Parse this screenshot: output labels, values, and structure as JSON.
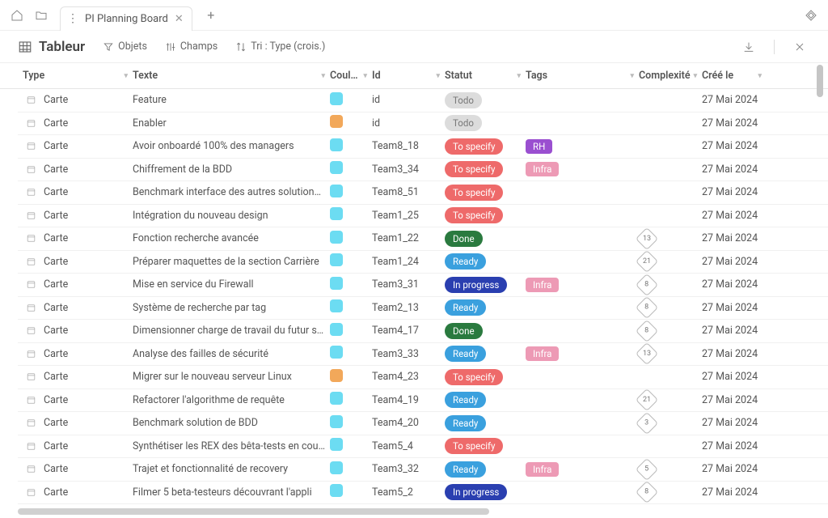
{
  "topbar": {
    "tab_title": "PI Planning Board"
  },
  "toolbar": {
    "title": "Tableur",
    "objets": "Objets",
    "champs": "Champs",
    "tri": "Tri : Type (crois.)"
  },
  "columns": {
    "type": "Type",
    "texte": "Texte",
    "coul": "Coul…",
    "id": "Id",
    "statut": "Statut",
    "tags": "Tags",
    "complex": "Complexité",
    "cree": "Créé le"
  },
  "type_label": "Carte",
  "rows": [
    {
      "texte": "Feature",
      "color": "cyan",
      "id": "id",
      "statut": "Todo",
      "statcls": "b-todo",
      "tag": "",
      "tagcls": "",
      "comp": "",
      "cree": "27 Mai 2024"
    },
    {
      "texte": "Enabler",
      "color": "orange",
      "id": "id",
      "statut": "Todo",
      "statcls": "b-todo",
      "tag": "",
      "tagcls": "",
      "comp": "",
      "cree": "27 Mai 2024"
    },
    {
      "texte": "Avoir onboardé 100% des managers",
      "color": "cyan",
      "id": "Team8_18",
      "statut": "To specify",
      "statcls": "b-spec",
      "tag": "RH",
      "tagcls": "t-rh",
      "comp": "",
      "cree": "27 Mai 2024"
    },
    {
      "texte": "Chiffrement de la BDD",
      "color": "cyan",
      "id": "Team3_34",
      "statut": "To specify",
      "statcls": "b-spec",
      "tag": "Infra",
      "tagcls": "t-infra",
      "comp": "",
      "cree": "27 Mai 2024"
    },
    {
      "texte": "Benchmark interface des autres solutions du marché",
      "color": "cyan",
      "id": "Team8_51",
      "statut": "To specify",
      "statcls": "b-spec",
      "tag": "",
      "tagcls": "",
      "comp": "",
      "cree": "27 Mai 2024"
    },
    {
      "texte": "Intégration du nouveau design",
      "color": "cyan",
      "id": "Team1_25",
      "statut": "To specify",
      "statcls": "b-spec",
      "tag": "",
      "tagcls": "",
      "comp": "",
      "cree": "27 Mai 2024"
    },
    {
      "texte": "Fonction recherche avancée",
      "color": "cyan",
      "id": "Team1_22",
      "statut": "Done",
      "statcls": "b-done",
      "tag": "",
      "tagcls": "",
      "comp": "13",
      "cree": "27 Mai 2024"
    },
    {
      "texte": "Préparer maquettes de la section Carrière",
      "color": "cyan",
      "id": "Team1_24",
      "statut": "Ready",
      "statcls": "b-ready",
      "tag": "",
      "tagcls": "",
      "comp": "21",
      "cree": "27 Mai 2024"
    },
    {
      "texte": "Mise en service du Firewall",
      "color": "cyan",
      "id": "Team3_31",
      "statut": "In progress",
      "statcls": "b-prog",
      "tag": "Infra",
      "tagcls": "t-infra",
      "comp": "8",
      "cree": "27 Mai 2024"
    },
    {
      "texte": "Système de recherche par tag",
      "color": "cyan",
      "id": "Team2_13",
      "statut": "Ready",
      "statcls": "b-ready",
      "tag": "",
      "tagcls": "",
      "comp": "8",
      "cree": "27 Mai 2024"
    },
    {
      "texte": "Dimensionner charge de travail du futur serveur",
      "color": "cyan",
      "id": "Team4_17",
      "statut": "Done",
      "statcls": "b-done",
      "tag": "",
      "tagcls": "",
      "comp": "8",
      "cree": "27 Mai 2024"
    },
    {
      "texte": "Analyse des failles de sécurité",
      "color": "cyan",
      "id": "Team3_33",
      "statut": "Ready",
      "statcls": "b-ready",
      "tag": "Infra",
      "tagcls": "t-infra",
      "comp": "13",
      "cree": "27 Mai 2024"
    },
    {
      "texte": "Migrer sur le nouveau serveur Linux",
      "color": "orange",
      "id": "Team4_23",
      "statut": "To specify",
      "statcls": "b-spec",
      "tag": "",
      "tagcls": "",
      "comp": "",
      "cree": "27 Mai 2024"
    },
    {
      "texte": "Refactorer l'algorithme de requête",
      "color": "cyan",
      "id": "Team4_19",
      "statut": "Ready",
      "statcls": "b-ready",
      "tag": "",
      "tagcls": "",
      "comp": "21",
      "cree": "27 Mai 2024"
    },
    {
      "texte": "Benchmark solution de BDD",
      "color": "cyan",
      "id": "Team4_20",
      "statut": "Ready",
      "statcls": "b-ready",
      "tag": "",
      "tagcls": "",
      "comp": "3",
      "cree": "27 Mai 2024"
    },
    {
      "texte": "Synthétiser les REX des bêta-tests en cours",
      "color": "cyan",
      "id": "Team5_4",
      "statut": "To specify",
      "statcls": "b-spec",
      "tag": "",
      "tagcls": "",
      "comp": "",
      "cree": "27 Mai 2024"
    },
    {
      "texte": "Trajet et fonctionnalité de recovery",
      "color": "cyan",
      "id": "Team3_32",
      "statut": "Ready",
      "statcls": "b-ready",
      "tag": "Infra",
      "tagcls": "t-infra",
      "comp": "5",
      "cree": "27 Mai 2024"
    },
    {
      "texte": "Filmer 5 beta-testeurs découvrant l'appli",
      "color": "cyan",
      "id": "Team5_2",
      "statut": "In progress",
      "statcls": "b-prog",
      "tag": "",
      "tagcls": "",
      "comp": "8",
      "cree": "27 Mai 2024"
    }
  ]
}
